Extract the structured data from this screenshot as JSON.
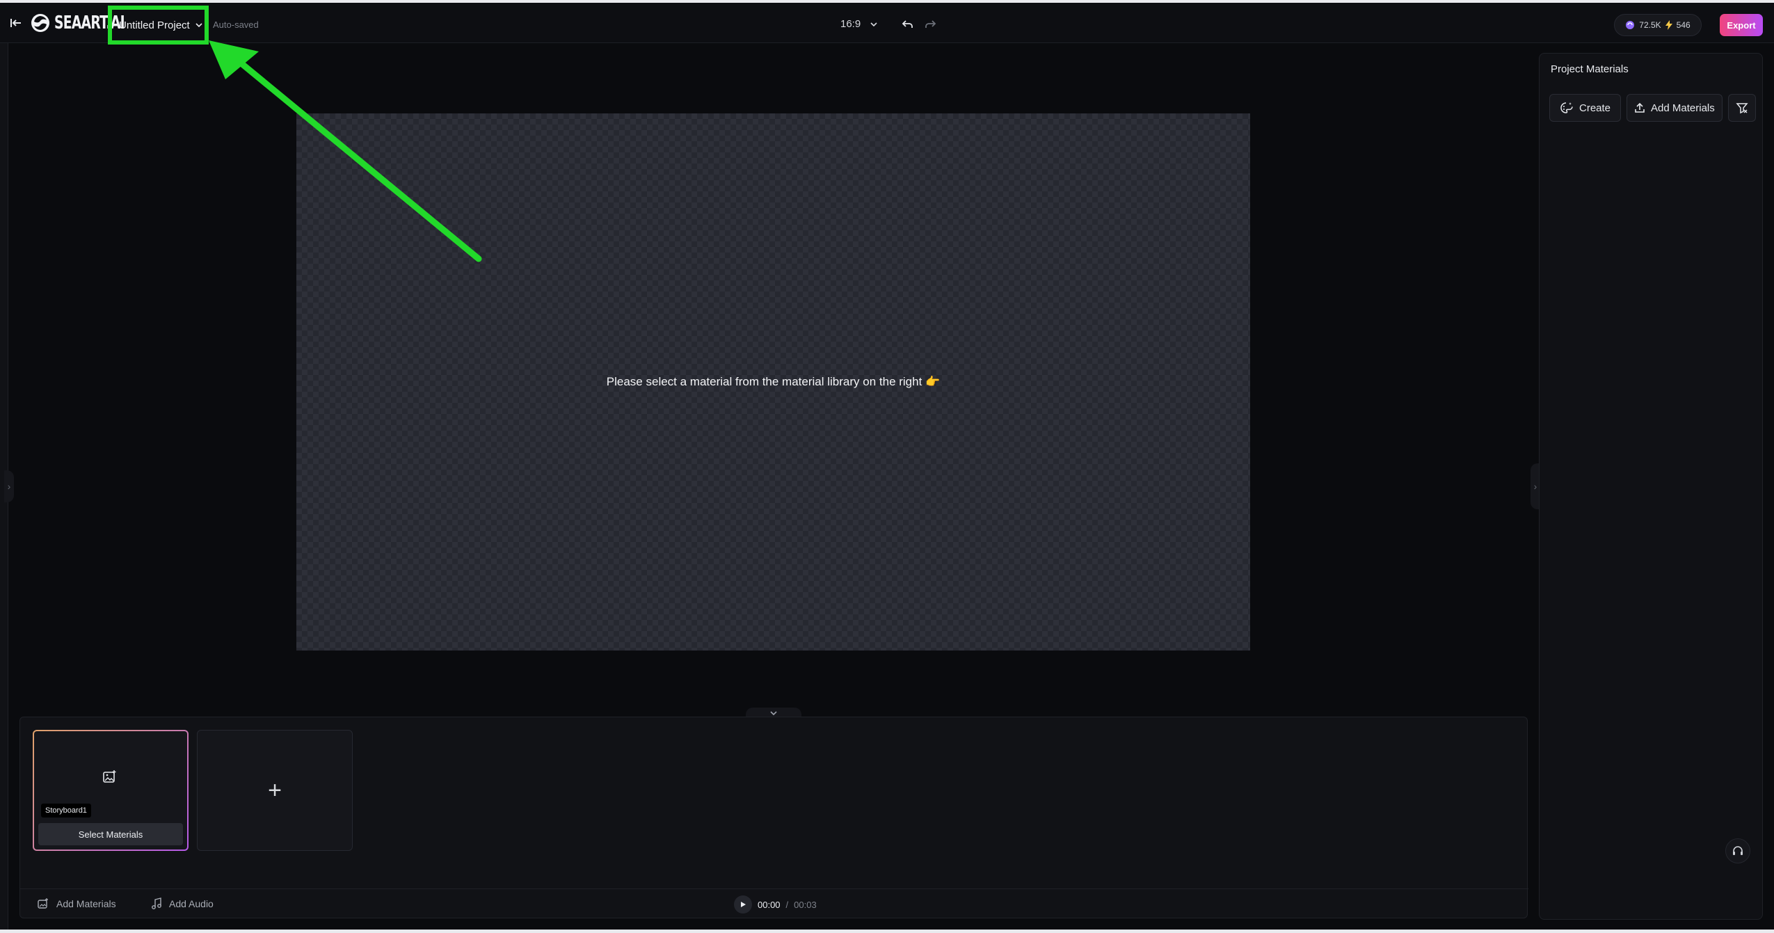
{
  "header": {
    "logo_text": "SEAART.AI",
    "project_name": "Untitled Project",
    "save_status": "Auto-saved",
    "aspect_ratio": "16:9",
    "credits_a": "72.5K",
    "credits_b": "546",
    "export_label": "Export"
  },
  "preview": {
    "message": "Please select a material from the material library on the right 👉"
  },
  "materials_panel": {
    "title": "Project Materials",
    "create_label": "Create",
    "add_label": "Add Materials"
  },
  "storyboard": {
    "cards": [
      {
        "tag": "Storyboard1",
        "select_label": "Select Materials"
      }
    ]
  },
  "bottom_bar": {
    "add_materials_label": "Add Materials",
    "add_audio_label": "Add Audio",
    "current_time": "00:00",
    "separator": "/",
    "total_time": "00:03"
  },
  "colors": {
    "annotation": "#22d92a",
    "export_gradient_start": "#f0447e",
    "export_gradient_end": "#b84cf5"
  },
  "icons": {
    "back": "exit-arrow-icon",
    "undo": "undo-icon",
    "redo": "redo-icon",
    "create": "palette-sparkle-icon",
    "upload": "upload-icon",
    "filter": "filter-icon",
    "image": "image-add-icon",
    "audio": "music-note-icon",
    "play": "play-icon",
    "support": "headset-icon"
  }
}
